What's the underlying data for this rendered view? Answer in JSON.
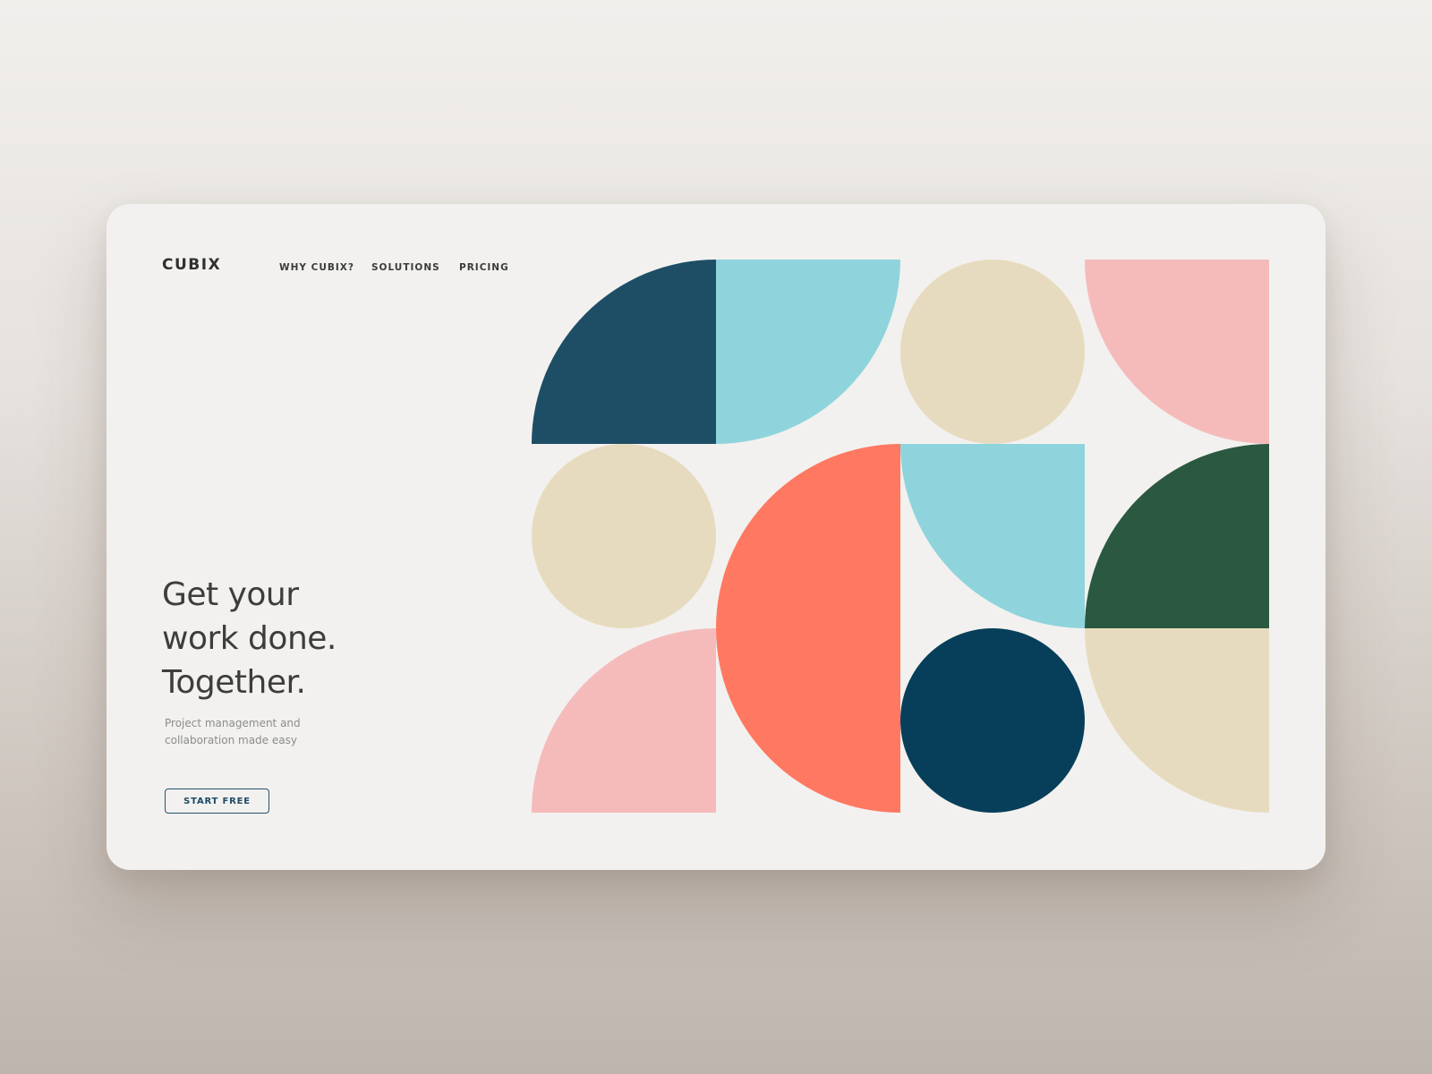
{
  "brand": {
    "name": "CUBIX"
  },
  "nav": {
    "items": [
      {
        "label": "WHY CUBIX?"
      },
      {
        "label": "SOLUTIONS"
      },
      {
        "label": "PRICING"
      }
    ]
  },
  "hero": {
    "headline_lines": [
      "Get your",
      "work done.",
      "Together."
    ],
    "subtitle_lines": [
      "Project management and",
      "collaboration made easy"
    ],
    "cta_label": "START FREE"
  },
  "palette": {
    "navy": "#1d4e66",
    "sky": "#8fd4dd",
    "sand": "#e7dbbf",
    "pink": "#f5bbba",
    "coral": "#ff7861",
    "forest": "#2b5840",
    "deep_navy": "#073f5a",
    "cta_border": "#27506a"
  }
}
